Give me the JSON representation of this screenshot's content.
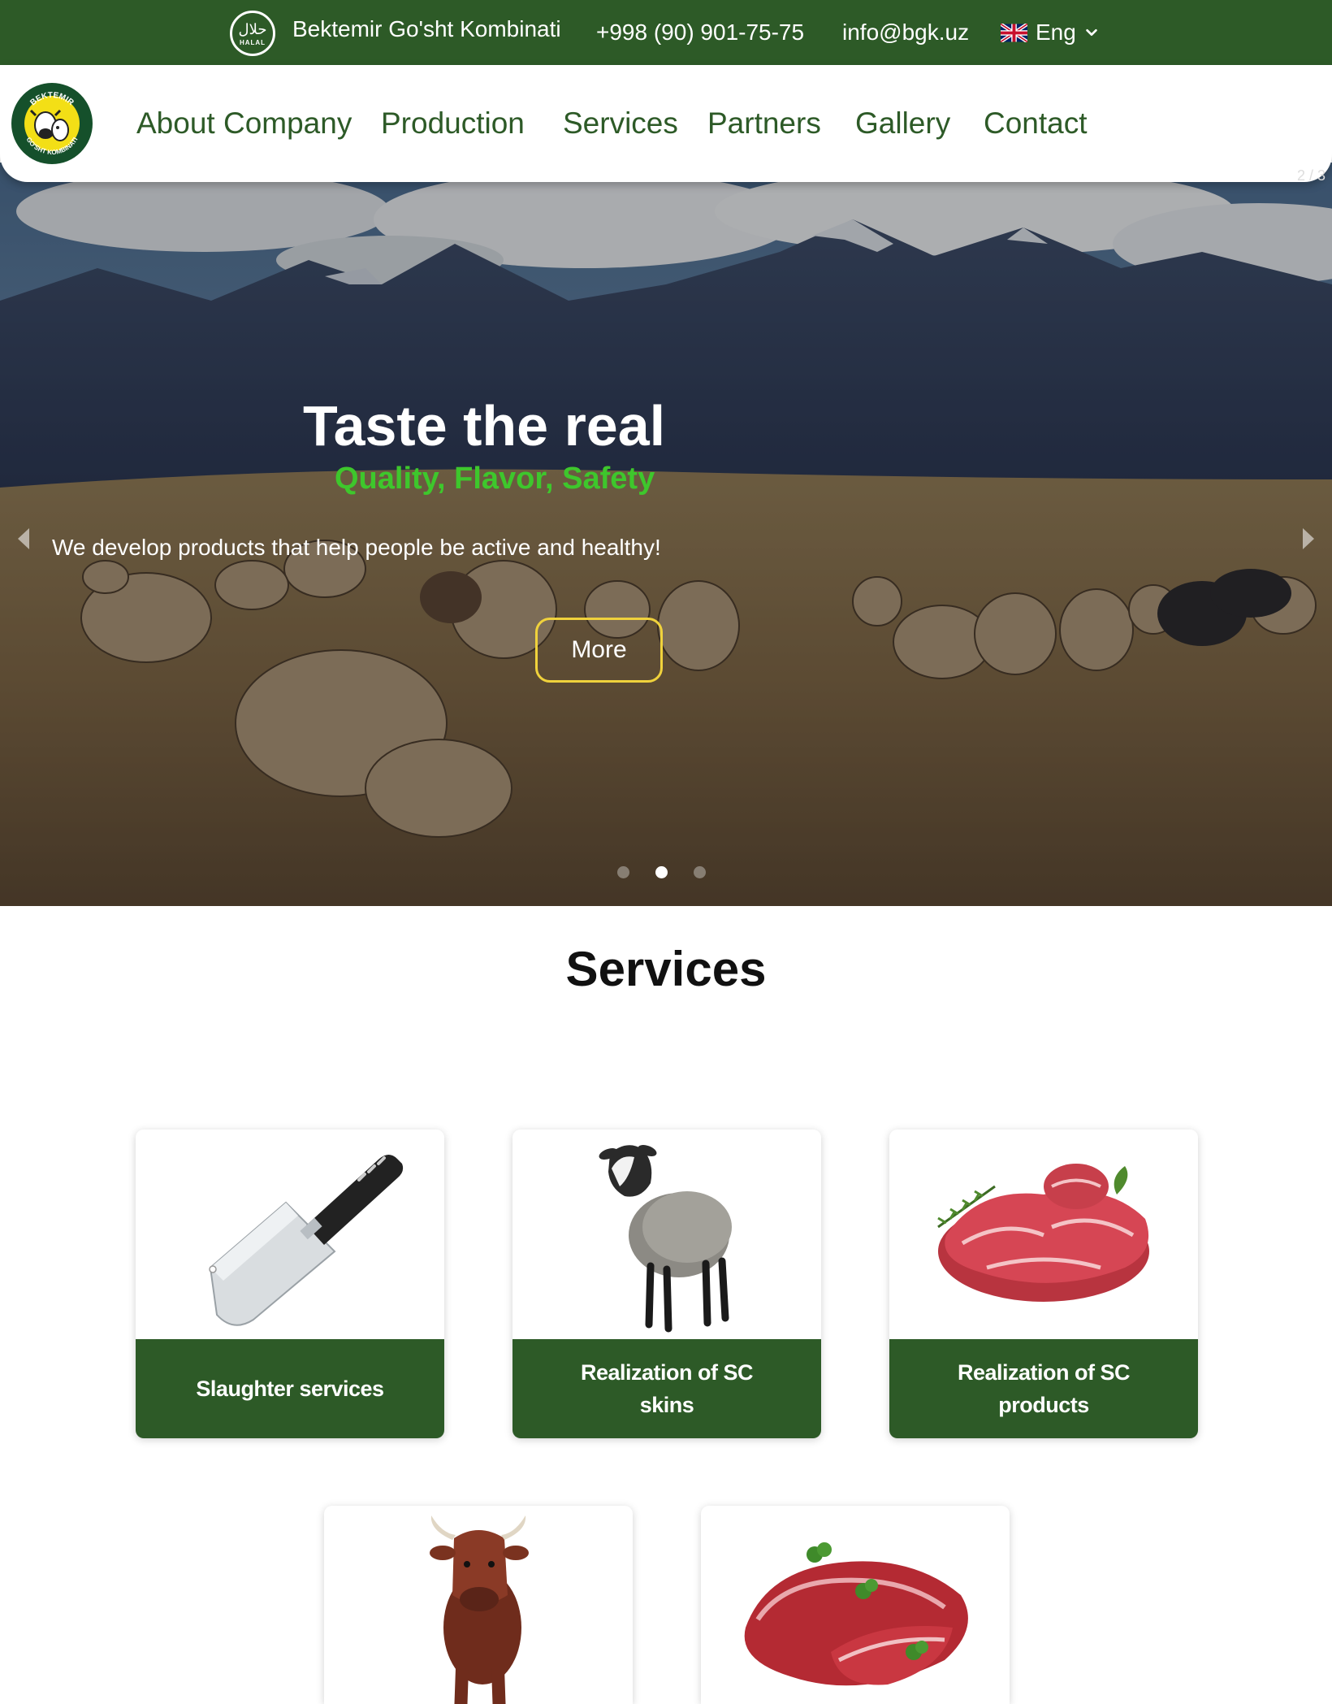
{
  "topbar": {
    "halal_ar": "حلال",
    "halal_latin": "HALAL",
    "brand": "Bektemir Go'sht Kombinati",
    "phone": "+998 (90) 901-75-75",
    "email": "info@bgk.uz",
    "language": "Eng",
    "language_icon": "uk-flag-icon",
    "bg_color": "#2d5a27"
  },
  "logo": {
    "top_text": "BEKTEMIR",
    "bottom_text": "GO'SHT KOMBINATI"
  },
  "nav": {
    "items": [
      {
        "label": "About Company"
      },
      {
        "label": "Production"
      },
      {
        "label": "Services"
      },
      {
        "label": "Partners"
      },
      {
        "label": "Gallery"
      },
      {
        "label": "Contact"
      }
    ],
    "color": "#2d5a27"
  },
  "hero": {
    "slide_counter": "2 / 3",
    "title": "Taste the real",
    "subtitle": "Quality, Flavor, Safety",
    "description": "We develop products that help people be active and healthy!",
    "button_label": "More",
    "active_slide": 2,
    "total_slides": 3,
    "subtitle_color": "#3ec72c",
    "button_border_color": "#f0d23c"
  },
  "services": {
    "title": "Services",
    "cards": [
      {
        "label": "Slaughter services",
        "icon": "cleaver-knife-icon"
      },
      {
        "label": "Realization of SC skins",
        "icon": "sheep-icon"
      },
      {
        "label": "Realization of SC products",
        "icon": "lamb-meat-icon"
      },
      {
        "label": "",
        "icon": "bull-icon"
      },
      {
        "label": "",
        "icon": "beef-steak-icon"
      }
    ]
  }
}
